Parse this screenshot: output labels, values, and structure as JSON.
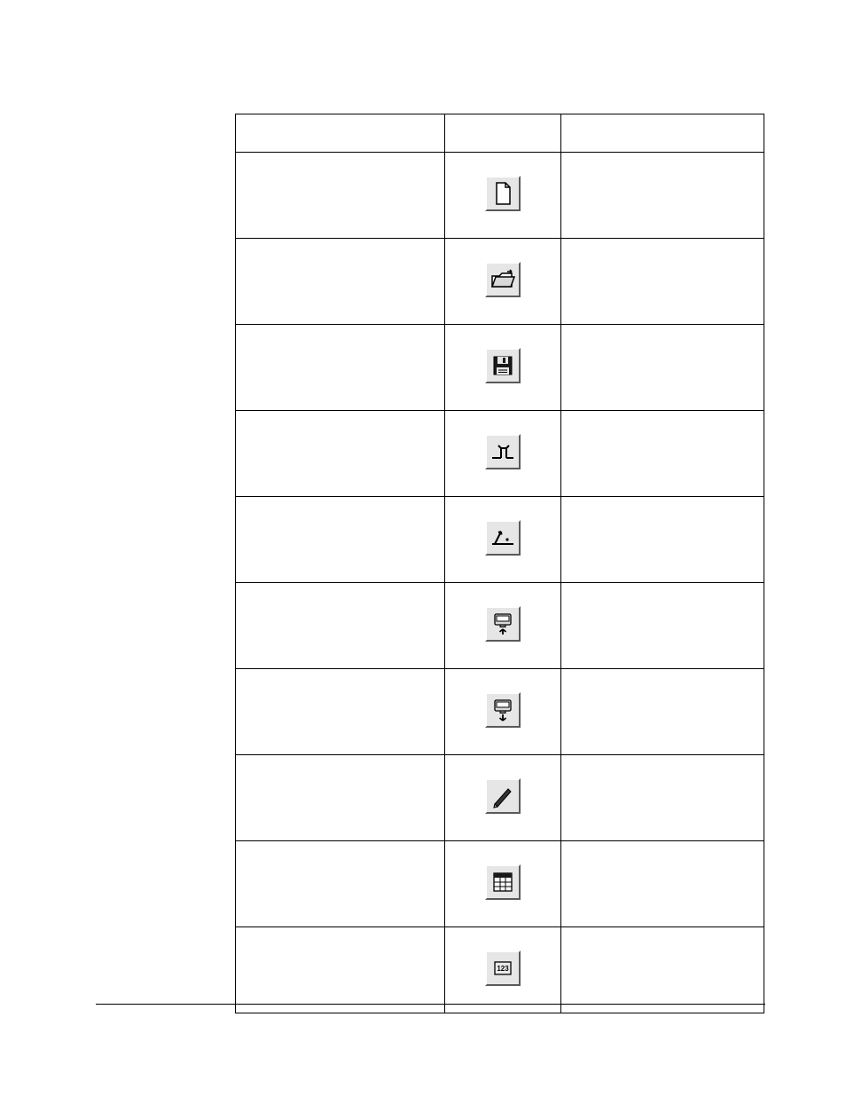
{
  "columns": [
    "",
    "",
    ""
  ],
  "rows": [
    {
      "label": "",
      "icon": "new-document-icon",
      "shortcut": ""
    },
    {
      "label": "",
      "icon": "open-folder-icon",
      "shortcut": ""
    },
    {
      "label": "",
      "icon": "save-icon",
      "shortcut": ""
    },
    {
      "label": "",
      "icon": "offline-icon",
      "shortcut": ""
    },
    {
      "label": "",
      "icon": "online-icon",
      "shortcut": ""
    },
    {
      "label": "",
      "icon": "upload-icon",
      "shortcut": ""
    },
    {
      "label": "",
      "icon": "download-icon",
      "shortcut": ""
    },
    {
      "label": "",
      "icon": "edit-pencil-icon",
      "shortcut": ""
    },
    {
      "label": "",
      "icon": "parameter-table-icon",
      "shortcut": ""
    },
    {
      "label": "",
      "icon": "position-123-icon",
      "shortcut": ""
    }
  ]
}
